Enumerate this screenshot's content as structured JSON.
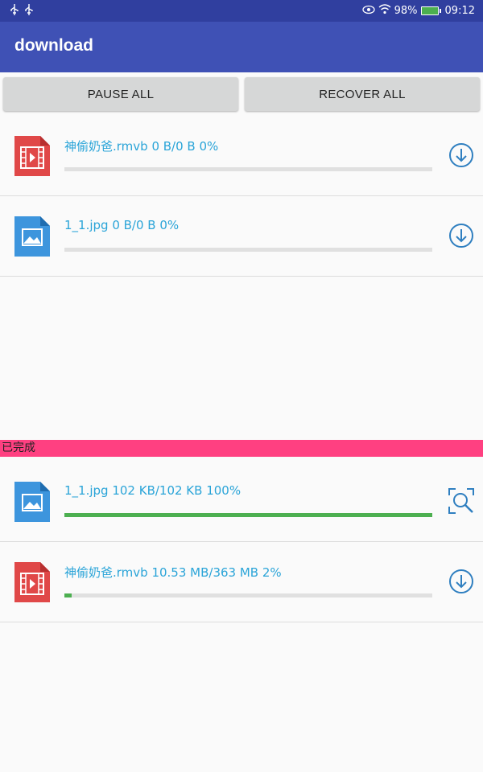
{
  "status_bar": {
    "battery": "98%",
    "time": "09:12",
    "icons": [
      "usb-icon",
      "usb-icon",
      "eye-icon",
      "wifi-icon",
      "battery-icon"
    ]
  },
  "app_bar": {
    "title": "download"
  },
  "buttons": {
    "pause_all": "PAUSE ALL",
    "recover_all": "RECOVER ALL"
  },
  "downloading": [
    {
      "title": "神偷奶爸.rmvb 0 B/0 B 0%",
      "progress": 0,
      "type": "video",
      "action": "download-icon"
    },
    {
      "title": "1_1.jpg 0 B/0 B 0%",
      "progress": 0,
      "type": "image",
      "action": "download-icon"
    }
  ],
  "completed_section": {
    "label": "已完成"
  },
  "completed": [
    {
      "title": "1_1.jpg 102 KB/102 KB 100%",
      "progress": 1.0,
      "type": "image",
      "action": "view-icon"
    },
    {
      "title": "神偷奶爸.rmvb 10.53 MB/363 MB 2%",
      "progress": 0.02,
      "type": "video",
      "action": "download-icon"
    }
  ],
  "colors": {
    "status_bar": "#303f9f",
    "app_bar": "#3f51b5",
    "accent": "#ff4081",
    "progress": "#4caf50",
    "title_text": "#2aa4d8"
  }
}
